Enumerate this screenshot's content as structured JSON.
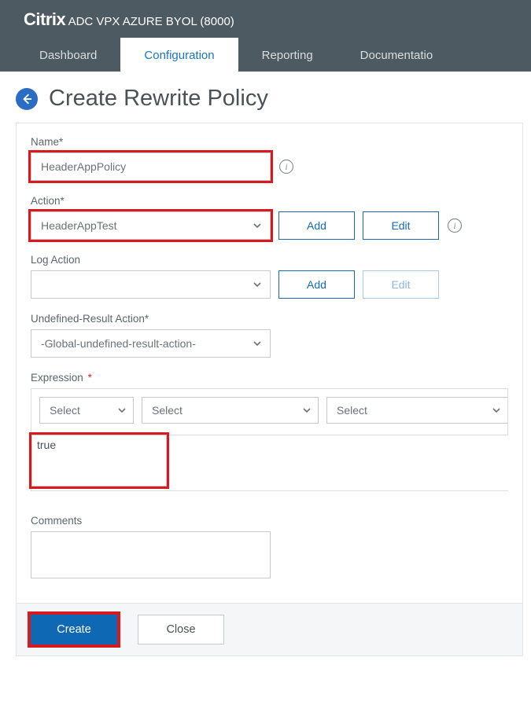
{
  "header": {
    "brand_bold": "Citrix",
    "brand_rest": " ADC VPX AZURE BYOL (8000)"
  },
  "tabs": {
    "dashboard": "Dashboard",
    "configuration": "Configuration",
    "reporting": "Reporting",
    "documentation": "Documentatio"
  },
  "page": {
    "title": "Create Rewrite Policy"
  },
  "form": {
    "name_label": "Name",
    "name_value": "HeaderAppPolicy",
    "action_label": "Action",
    "action_value": "HeaderAppTest",
    "add_label": "Add",
    "edit_label": "Edit",
    "log_action_label": "Log Action",
    "log_action_value": "",
    "undefined_label": "Undefined-Result Action",
    "undefined_value": "-Global-undefined-result-action-",
    "expression_label": "Expression",
    "exp_select1": "Select",
    "exp_select2": "Select",
    "exp_select3": "Select",
    "exp_value": "true",
    "comments_label": "Comments",
    "comments_value": ""
  },
  "buttons": {
    "create": "Create",
    "close": "Close"
  }
}
